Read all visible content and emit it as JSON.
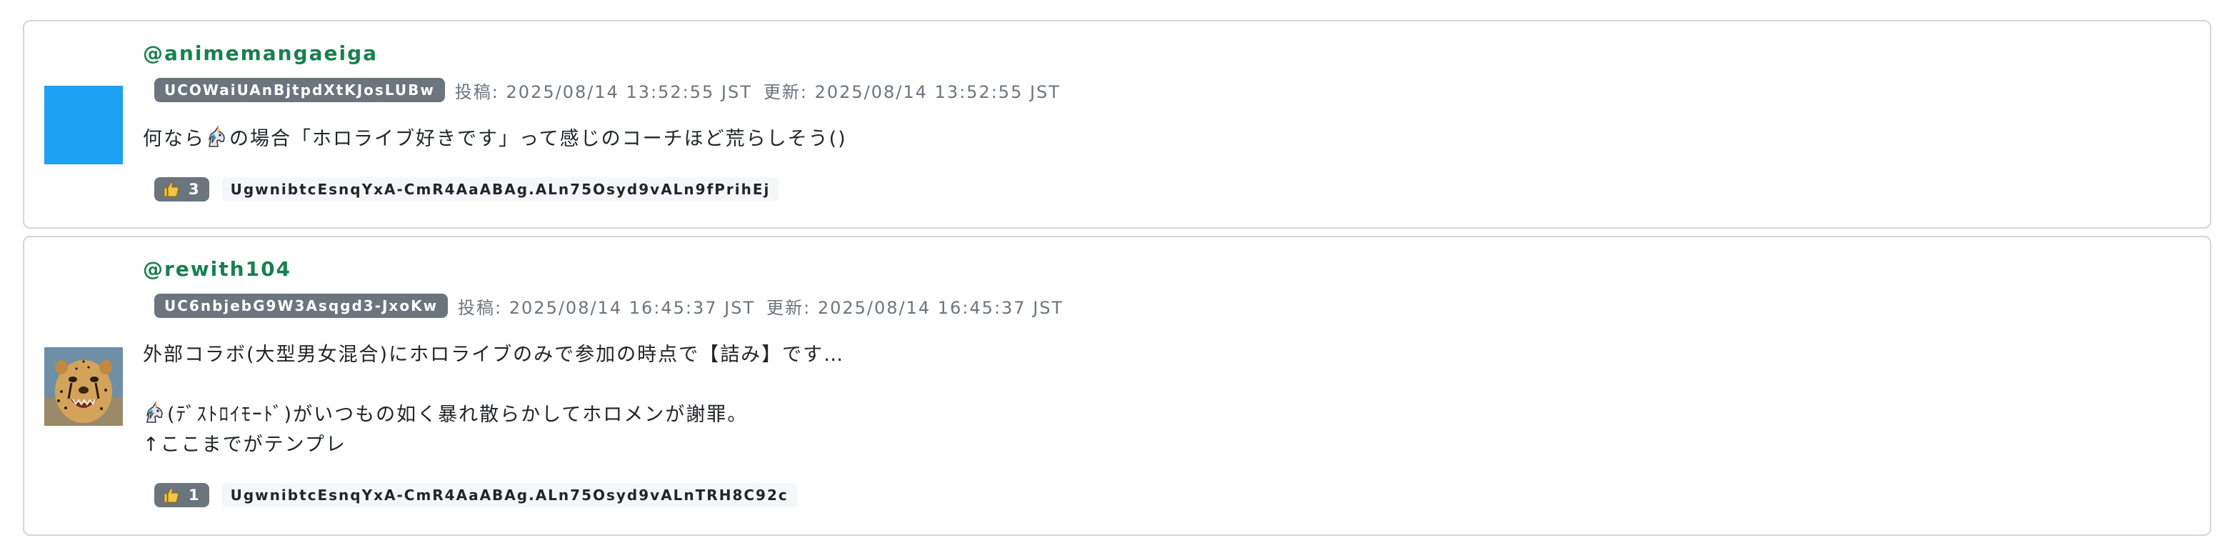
{
  "comments": [
    {
      "username": "@animemangaeiga",
      "channel_id": "UCOWaiUAnBjtpdXtKJosLUBw",
      "posted": "投稿: 2025/08/14 13:52:55 JST",
      "updated": "更新: 2025/08/14 13:52:55 JST",
      "avatar": "solid-blue",
      "text_before_emoji": "何なら",
      "text_after_emoji": "の場合「ホロライブ好きです」って感じのコーチほど荒らしそう()",
      "likes": "3",
      "comment_id": "UgwnibtcEsnqYxA-CmR4AaABAg.ALn75Osyd9vALn9fPrihEj"
    },
    {
      "username": "@rewith104",
      "channel_id": "UC6nbjebG9W3Asqgd3-JxoKw",
      "posted": "投稿: 2025/08/14 16:45:37 JST",
      "updated": "更新: 2025/08/14 16:45:37 JST",
      "avatar": "cheetah-photo",
      "line1": "外部コラボ(大型男女混合)にホロライブのみで参加の時点で【詰み】です…",
      "line2_after_emoji": "(ﾃﾞｽﾄﾛｲﾓｰﾄﾞ)がいつもの如く暴れ散らかしてホロメンが謝罪。",
      "line3": "↑ここまでがテンプレ",
      "likes": "1",
      "comment_id": "UgwnibtcEsnqYxA-CmR4AaABAg.ALn75Osyd9vALnTRH8C92c"
    }
  ],
  "colors": {
    "username": "#188050",
    "badge": "#6c757d",
    "avatar_blue": "#1da1f2",
    "border": "#d3d6d9"
  },
  "icons": {
    "like": "thumbs-up-icon",
    "emoji": "unicorn-icon"
  }
}
